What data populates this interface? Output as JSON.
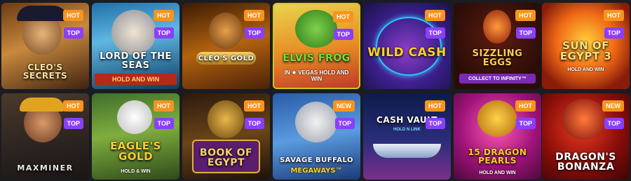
{
  "badges": {
    "hot": "HOT",
    "top": "TOP",
    "new": "NEW",
    "colors": {
      "hot": "#f7931e",
      "top": "#8a3ffc",
      "new": "#f7931e"
    }
  },
  "games": [
    {
      "title": "CLEO'S SECRETS",
      "sub": "",
      "badges": [
        "HOT",
        "TOP"
      ]
    },
    {
      "title": "LORD OF THE SEAS",
      "sub": "HOLD AND WIN",
      "badges": [
        "HOT",
        "TOP"
      ]
    },
    {
      "title": "CLEO'S GOLD",
      "sub": "",
      "badges": [
        "HOT",
        "TOP"
      ]
    },
    {
      "title": "ELVIS FROG",
      "sub": "IN ★ VEGAS HOLD AND WIN",
      "badges": [
        "HOT",
        "TOP"
      ]
    },
    {
      "title": "WILD CASH",
      "sub": "",
      "badges": [
        "HOT",
        "TOP"
      ]
    },
    {
      "title": "SIZZLING EGGS",
      "sub": "COLLECT TO INFINITY™",
      "badges": [
        "HOT",
        "TOP"
      ]
    },
    {
      "title": "SUN OF EGYPT 3",
      "sub": "HOLD AND WIN",
      "badges": [
        "HOT",
        "TOP"
      ]
    },
    {
      "title": "MAXMINER",
      "sub": "",
      "badges": [
        "HOT",
        "TOP"
      ]
    },
    {
      "title": "EAGLE'S GOLD",
      "sub": "HOLD & WIN",
      "badges": [
        "HOT",
        "TOP"
      ]
    },
    {
      "title": "BOOK OF EGYPT",
      "sub": "",
      "badges": [
        "HOT",
        "TOP"
      ]
    },
    {
      "title": "SAVAGE BUFFALO",
      "sub": "MEGAWAYS™",
      "badges": [
        "NEW",
        "TOP"
      ]
    },
    {
      "title": "CASH VAULT",
      "sub": "HOLD N LINK",
      "badges": [
        "HOT",
        "TOP"
      ]
    },
    {
      "title": "15 DRAGON PEARLS",
      "sub": "HOLD AND WIN",
      "badges": [
        "HOT",
        "TOP"
      ]
    },
    {
      "title": "DRAGON'S BONANZA",
      "sub": "",
      "badges": [
        "NEW",
        "TOP"
      ]
    }
  ]
}
